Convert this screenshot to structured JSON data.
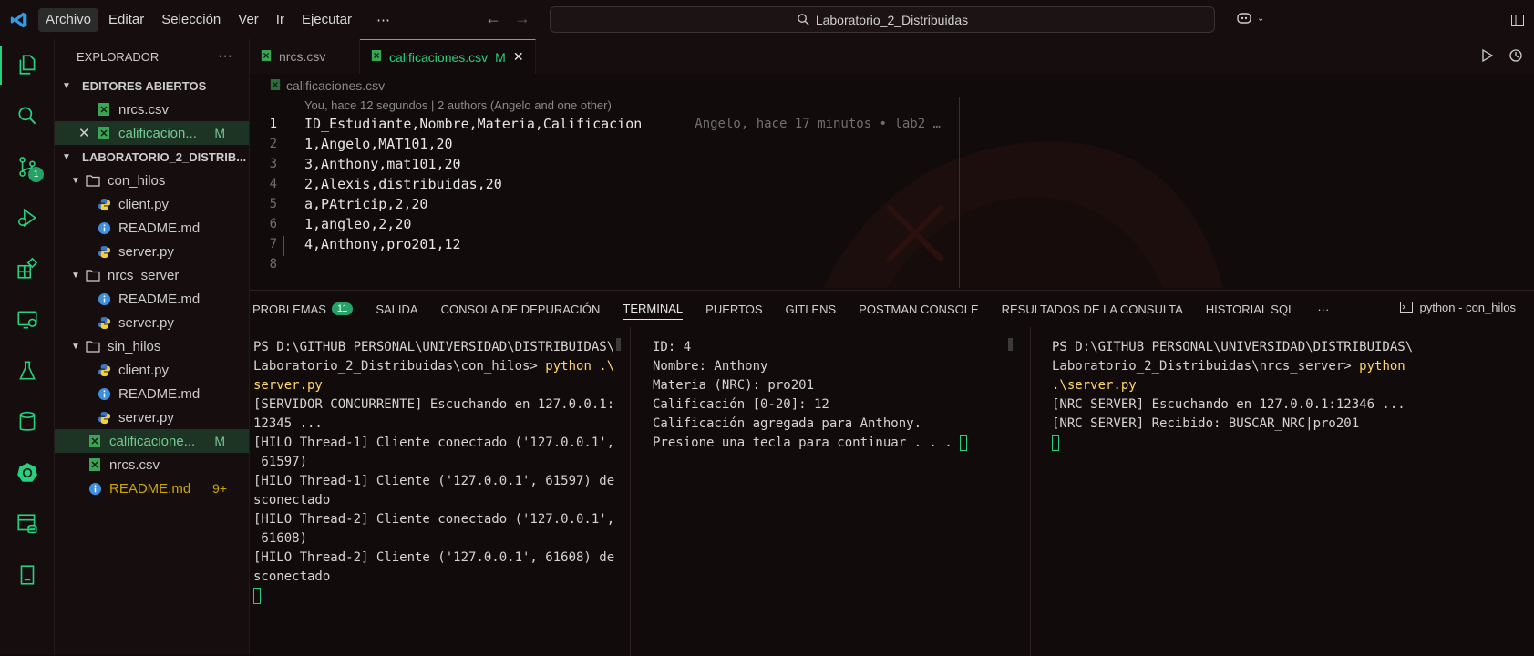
{
  "titlebar": {
    "menu": [
      "Archivo",
      "Editar",
      "Selección",
      "Ver",
      "Ir",
      "Ejecutar",
      "⋯"
    ],
    "search_text": "Laboratorio_2_Distribuidas"
  },
  "sidebar": {
    "title": "EXPLORADOR",
    "more": "···",
    "open_editors_label": "EDITORES ABIERTOS",
    "open_editors": [
      {
        "name": "nrcs.csv",
        "status": ""
      },
      {
        "name": "calificacion...",
        "status": "M"
      }
    ],
    "project_label": "LABORATORIO_2_DISTRIB...",
    "tree": [
      {
        "name": "con_hilos",
        "type": "folder",
        "depth": 1
      },
      {
        "name": "client.py",
        "type": "python",
        "depth": 2
      },
      {
        "name": "README.md",
        "type": "info",
        "depth": 2
      },
      {
        "name": "server.py",
        "type": "python",
        "depth": 2
      },
      {
        "name": "nrcs_server",
        "type": "folder",
        "depth": 1
      },
      {
        "name": "README.md",
        "type": "info",
        "depth": 2
      },
      {
        "name": "server.py",
        "type": "python",
        "depth": 2
      },
      {
        "name": "sin_hilos",
        "type": "folder",
        "depth": 1
      },
      {
        "name": "client.py",
        "type": "python",
        "depth": 2
      },
      {
        "name": "README.md",
        "type": "info",
        "depth": 2
      },
      {
        "name": "server.py",
        "type": "python",
        "depth": 2
      },
      {
        "name": "calificacione...",
        "type": "csv",
        "depth": 1,
        "status": "M"
      },
      {
        "name": "nrcs.csv",
        "type": "csv",
        "depth": 1
      },
      {
        "name": "README.md",
        "type": "info",
        "depth": 1,
        "status": "9+"
      }
    ]
  },
  "activity": {
    "scm_badge": "1"
  },
  "tabs": [
    {
      "label": "nrcs.csv",
      "status": ""
    },
    {
      "label": "calificaciones.csv",
      "status": "M"
    }
  ],
  "breadcrumb": "calificaciones.csv",
  "editor": {
    "codelens": "You, hace 12 segundos | 2 authors (Angelo and one other)",
    "lines": [
      {
        "n": "1",
        "text": "ID_Estudiante,Nombre,Materia,Calificacion",
        "blame": "Angelo, hace 17 minutos • lab2 …"
      },
      {
        "n": "2",
        "text": "1,Angelo,MAT101,20"
      },
      {
        "n": "3",
        "text": "3,Anthony,mat101,20"
      },
      {
        "n": "4",
        "text": "2,Alexis,distribuidas,20"
      },
      {
        "n": "5",
        "text": "a,PAtricip,2,20"
      },
      {
        "n": "6",
        "text": "1,angleo,2,20"
      },
      {
        "n": "7",
        "text": "4,Anthony,pro201,12"
      },
      {
        "n": "8",
        "text": ""
      }
    ]
  },
  "panel": {
    "tabs": [
      "PROBLEMAS",
      "SALIDA",
      "CONSOLA DE DEPURACIÓN",
      "TERMINAL",
      "PUERTOS",
      "GITLENS",
      "POSTMAN CONSOLE",
      "RESULTADOS DE LA CONSULTA",
      "HISTORIAL SQL",
      "···"
    ],
    "problems_count": "11",
    "active_terminal": "python - con_hilos",
    "term1": {
      "prompt": "PS D:\\GITHUB PERSONAL\\UNIVERSIDAD\\DISTRIBUIDAS\\\nLaboratorio_2_Distribuidas\\con_hilos> ",
      "cmd1": "python .\\",
      "cmd2": "server.py",
      "output": "[SERVIDOR CONCURRENTE] Escuchando en 127.0.0.1:\n12345 ...\n[HILO Thread-1] Cliente conectado ('127.0.0.1',\n 61597)\n[HILO Thread-1] Cliente ('127.0.0.1', 61597) de\nsconectado\n[HILO Thread-2] Cliente conectado ('127.0.0.1',\n 61608)\n[HILO Thread-2] Cliente ('127.0.0.1', 61608) de\nsconectado"
    },
    "term2": {
      "output": "ID: 4\nNombre: Anthony\nMateria (NRC): pro201\nCalificación [0-20]: 12\nCalificación agregada para Anthony.\nPresione una tecla para continuar . . . "
    },
    "term3": {
      "prompt": "PS D:\\GITHUB PERSONAL\\UNIVERSIDAD\\DISTRIBUIDAS\\\nLaboratorio_2_Distribuidas\\nrcs_server> ",
      "cmd1": "python",
      "cmd2": ".\\server.py",
      "output": "[NRC SERVER] Escuchando en 127.0.0.1:12346 ...\n[NRC SERVER] Recibido: BUSCAR_NRC|pro201"
    }
  }
}
